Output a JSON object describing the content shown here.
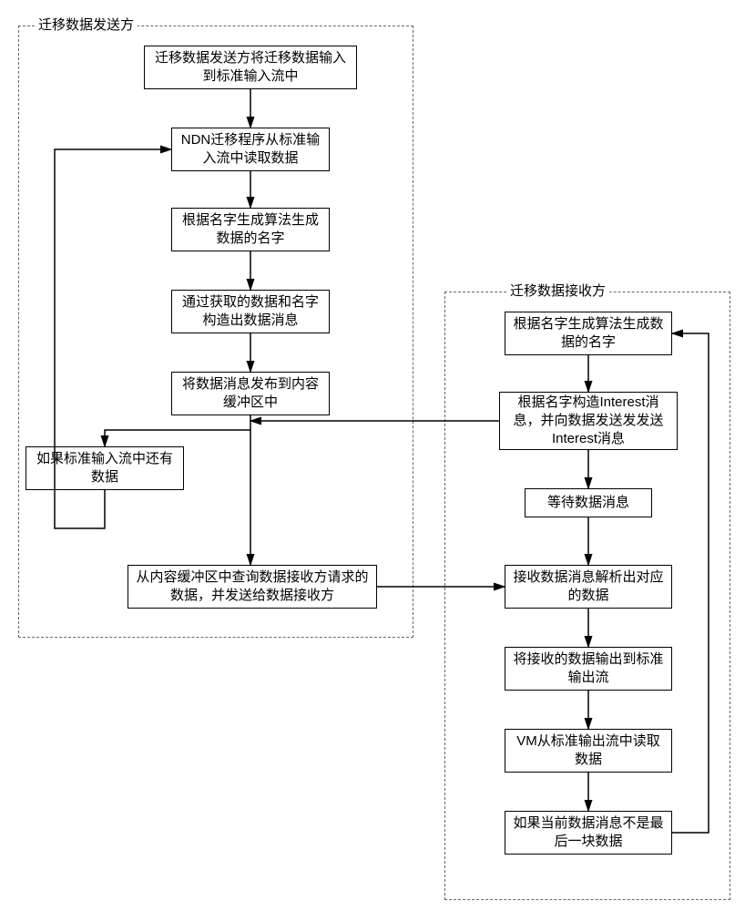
{
  "sender": {
    "title": "迁移数据发送方",
    "steps": {
      "s1": "迁移数据发送方将迁移数据输入到标准输入流中",
      "s2": "NDN迁移程序从标准输入流中读取数据",
      "s3": "根据名字生成算法生成数据的名字",
      "s4": "通过获取的数据和名字构造出数据消息",
      "s5": "将数据消息发布到内容缓冲区中",
      "s6": "如果标准输入流中还有数据",
      "s7": "从内容缓冲区中查询数据接收方请求的数据，并发送给数据接收方"
    }
  },
  "receiver": {
    "title": "迁移数据接收方",
    "steps": {
      "r1": "根据名字生成算法生成数据的名字",
      "r2": "根据名字构造Interest消息，并向数据发送发发送Interest消息",
      "r3": "等待数据消息",
      "r4": "接收数据消息解析出对应的数据",
      "r5": "将接收的数据输出到标准输出流",
      "r6": "VM从标准输出流中读取数据",
      "r7": "如果当前数据消息不是最后一块数据"
    }
  }
}
